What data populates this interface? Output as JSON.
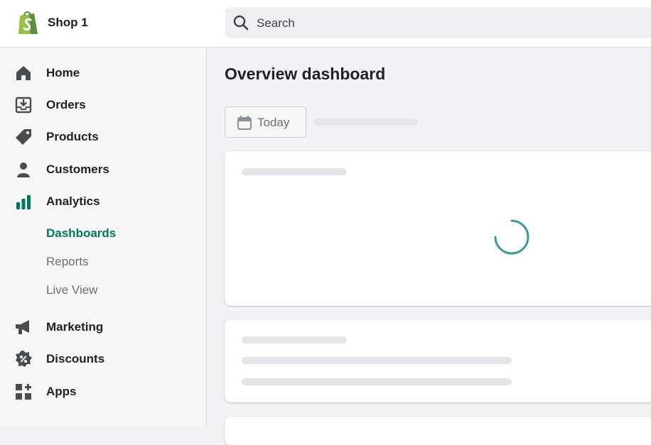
{
  "topbar": {
    "shop_name": "Shop 1",
    "search_placeholder": "Search"
  },
  "sidebar": {
    "items": [
      {
        "label": "Home",
        "icon": "home-icon"
      },
      {
        "label": "Orders",
        "icon": "orders-icon"
      },
      {
        "label": "Products",
        "icon": "tag-icon"
      },
      {
        "label": "Customers",
        "icon": "person-icon"
      },
      {
        "label": "Analytics",
        "icon": "bar-chart-icon"
      }
    ],
    "analytics_sub": [
      {
        "label": "Dashboards",
        "active": true
      },
      {
        "label": "Reports",
        "active": false
      },
      {
        "label": "Live View",
        "active": false
      }
    ],
    "items2": [
      {
        "label": "Marketing",
        "icon": "megaphone-icon"
      },
      {
        "label": "Discounts",
        "icon": "discount-icon"
      },
      {
        "label": "Apps",
        "icon": "apps-icon"
      }
    ]
  },
  "main": {
    "title": "Overview dashboard",
    "date_button": "Today"
  },
  "colors": {
    "accent": "#007a5a",
    "spinner": "#3d9a9b",
    "skeleton": "#e3e5e8"
  }
}
